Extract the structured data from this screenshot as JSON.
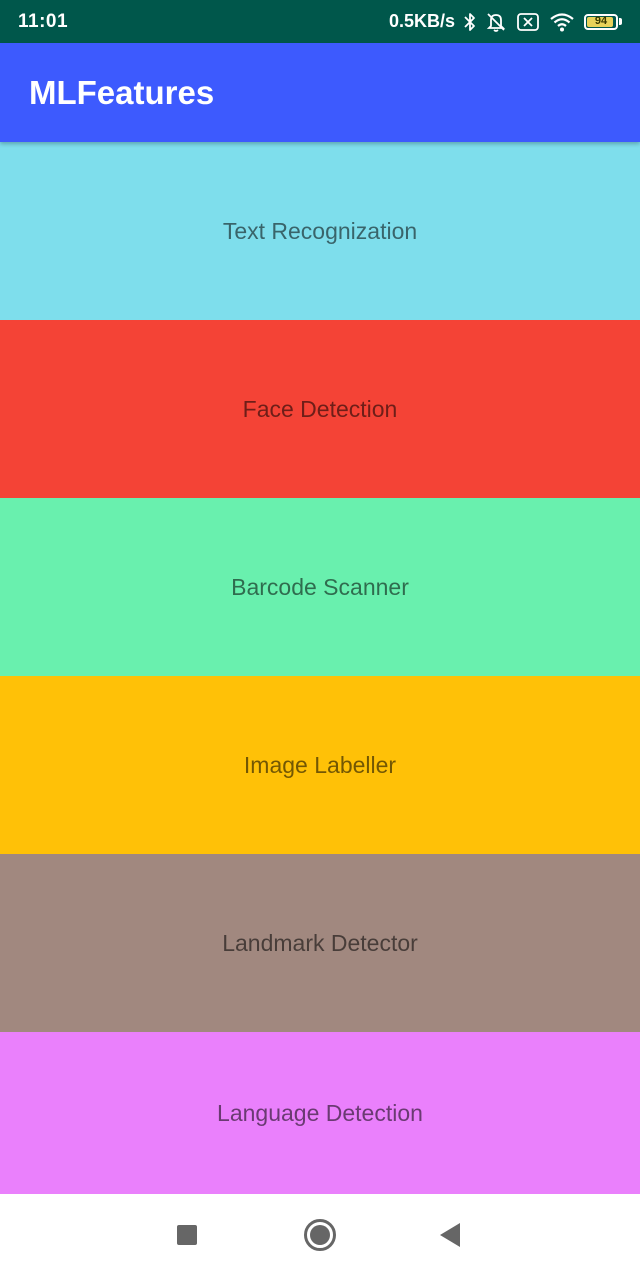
{
  "status_bar": {
    "time": "11:01",
    "network_speed": "0.5KB/s",
    "battery_level": "94",
    "battery_fraction": 0.94,
    "icons": [
      "bluetooth-icon",
      "notification-off-icon",
      "sim-off-icon",
      "wifi-icon",
      "battery-icon"
    ]
  },
  "app_bar": {
    "title": "MLFeatures",
    "color": "#3d5afe"
  },
  "features": [
    {
      "label": "Text Recognization",
      "color": "#7edeec"
    },
    {
      "label": "Face Detection",
      "color": "#f44336"
    },
    {
      "label": "Barcode Scanner",
      "color": "#69f0ae"
    },
    {
      "label": "Image Labeller",
      "color": "#ffc107"
    },
    {
      "label": "Landmark Detector",
      "color": "#a1887f"
    },
    {
      "label": "Language Detection",
      "color": "#ea80fc"
    }
  ],
  "nav_bar": {
    "icons": [
      "recents-icon",
      "home-icon",
      "back-icon"
    ]
  }
}
